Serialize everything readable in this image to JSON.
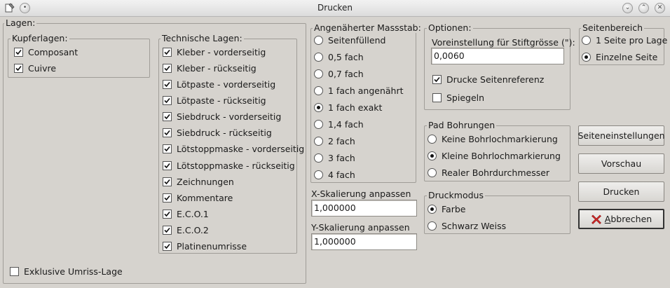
{
  "window": {
    "title": "Drucken"
  },
  "layers": {
    "group_label": "Lagen:",
    "copper": {
      "label": "Kupferlagen:",
      "items": [
        {
          "label": "Composant",
          "checked": true
        },
        {
          "label": "Cuivre",
          "checked": true
        }
      ]
    },
    "technical": {
      "label": "Technische Lagen:",
      "items": [
        {
          "label": "Kleber - vorderseitig",
          "checked": true
        },
        {
          "label": "Kleber - rückseitig",
          "checked": true
        },
        {
          "label": "Lötpaste - vorderseitig",
          "checked": true
        },
        {
          "label": "Lötpaste - rückseitig",
          "checked": true
        },
        {
          "label": "Siebdruck - vorderseitig",
          "checked": true
        },
        {
          "label": "Siebdruck - rückseitig",
          "checked": true
        },
        {
          "label": "Lötstoppmaske - vorderseitig",
          "checked": true
        },
        {
          "label": "Lötstoppmaske - rückseitig",
          "checked": true
        },
        {
          "label": "Zeichnungen",
          "checked": true
        },
        {
          "label": "Kommentare",
          "checked": true
        },
        {
          "label": "E.C.O.1",
          "checked": true
        },
        {
          "label": "E.C.O.2",
          "checked": true
        },
        {
          "label": "Platinenumrisse",
          "checked": true
        }
      ]
    },
    "exclusive_edge": {
      "label": "Exklusive Umriss-Lage",
      "checked": false
    }
  },
  "scale": {
    "label": "Angenäherter Massstab:",
    "options": [
      {
        "label": "Seitenfüllend",
        "selected": false
      },
      {
        "label": "0,5 fach",
        "selected": false
      },
      {
        "label": "0,7 fach",
        "selected": false
      },
      {
        "label": "1 fach angenährt",
        "selected": false
      },
      {
        "label": "1 fach exakt",
        "selected": true
      },
      {
        "label": "1,4 fach",
        "selected": false
      },
      {
        "label": "2 fach",
        "selected": false
      },
      {
        "label": "3 fach",
        "selected": false
      },
      {
        "label": "4 fach",
        "selected": false
      }
    ],
    "x_adjust": {
      "label": "X-Skalierung anpassen",
      "value": "1,000000"
    },
    "y_adjust": {
      "label": "Y-Skalierung anpassen",
      "value": "1,000000"
    }
  },
  "options": {
    "label": "Optionen:",
    "pen_size_label": "Voreinstellung für Stiftgrösse (\"):",
    "pen_size_value": "0,0060",
    "page_reference": {
      "label": "Drucke Seitenreferenz",
      "checked": true
    },
    "mirror": {
      "label": "Spiegeln",
      "checked": false
    }
  },
  "drill": {
    "label": "Pad Bohrungen",
    "options": [
      {
        "label": "Keine Bohrlochmarkierung",
        "selected": false
      },
      {
        "label": "Kleine Bohrlochmarkierung",
        "selected": true
      },
      {
        "label": "Realer Bohrdurchmesser",
        "selected": false
      }
    ]
  },
  "print_mode": {
    "label": "Druckmodus",
    "options": [
      {
        "label": "Farbe",
        "selected": true
      },
      {
        "label": "Schwarz Weiss",
        "selected": false
      }
    ]
  },
  "page_range": {
    "label": "Seitenbereich",
    "options": [
      {
        "label": "1 Seite pro Lage",
        "selected": false
      },
      {
        "label": "Einzelne Seite",
        "selected": true
      }
    ]
  },
  "buttons": {
    "page_setup": "Seiteneinstellungen",
    "preview": "Vorschau",
    "print": "Drucken",
    "cancel_prefix": "A",
    "cancel_rest": "bbrechen"
  },
  "colors": {
    "cancel_icon": "#d42a2a",
    "window_bg": "#d6d3ce"
  }
}
